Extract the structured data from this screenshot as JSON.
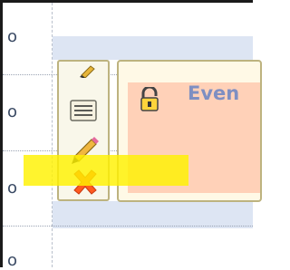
{
  "time_labels": [
    "o",
    "o",
    "o",
    "o"
  ],
  "event": {
    "title": "Even",
    "lock_icon": "lock-icon"
  },
  "actions": [
    {
      "name": "edit-small",
      "icon": "pencil-icon"
    },
    {
      "name": "notes",
      "icon": "notes-icon"
    },
    {
      "name": "edit",
      "icon": "pencil-icon"
    },
    {
      "name": "delete",
      "icon": "close-icon"
    }
  ],
  "colors": {
    "row_band": "#dde5f3",
    "event_fill": "#ffd1b8",
    "card_border": "#bdb37f",
    "title": "#7e8fc2",
    "highlight": "#fff200",
    "delete": "#ff5a1f"
  }
}
